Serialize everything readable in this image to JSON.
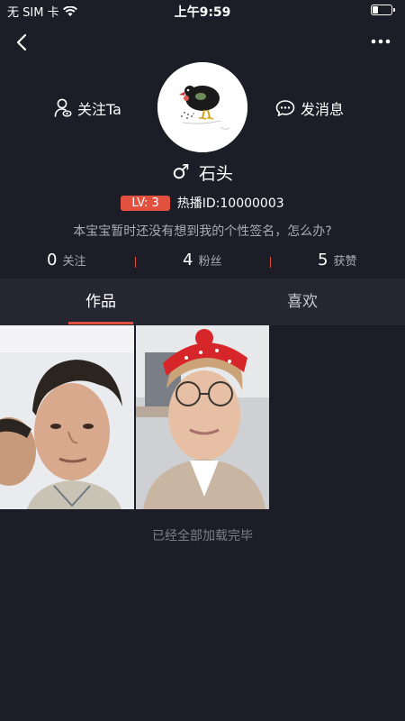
{
  "status_bar": {
    "carrier": "无 SIM 卡",
    "time": "上午9:59",
    "battery_level": 0.35
  },
  "header": {
    "back_icon": "chevron-left-icon",
    "more_icon": "ellipsis-icon"
  },
  "profile": {
    "follow_label": "关注Ta",
    "message_label": "发消息",
    "gender_symbol": "♂",
    "name": "石头",
    "level": "LV: 3",
    "id_text": "热播ID:10000003",
    "signature": "本宝宝暂时还没有想到我的个性签名，怎么办?"
  },
  "stats": [
    {
      "value": "0",
      "label": "关注"
    },
    {
      "value": "4",
      "label": "粉丝"
    },
    {
      "value": "5",
      "label": "获赞"
    }
  ],
  "tabs": [
    {
      "label": "作品",
      "active": true
    },
    {
      "label": "喜欢",
      "active": false
    }
  ],
  "footer": {
    "loaded_text": "已经全部加载完毕"
  },
  "colors": {
    "background": "#1c1d26",
    "tab_bar": "#252632",
    "accent": "#e2513f"
  }
}
